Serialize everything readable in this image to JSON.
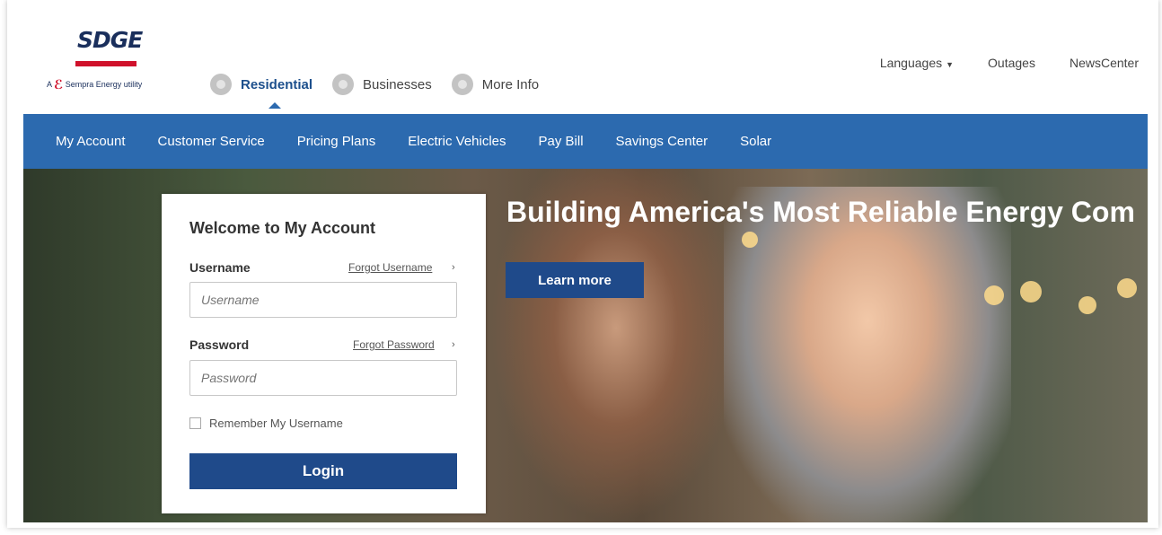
{
  "brand": {
    "logo_text": "SDGE",
    "tagline": "Sempra Energy utility",
    "colors": {
      "primary": "#2c6aaf",
      "button": "#1f4a8a",
      "brand_red": "#d0112b"
    }
  },
  "segments": [
    {
      "label": "Residential",
      "active": true
    },
    {
      "label": "Businesses",
      "active": false
    },
    {
      "label": "More Info",
      "active": false
    }
  ],
  "utility_nav": {
    "languages": "Languages",
    "outages": "Outages",
    "newscenter": "NewsCenter"
  },
  "main_nav": [
    "My Account",
    "Customer Service",
    "Pricing Plans",
    "Electric Vehicles",
    "Pay Bill",
    "Savings Center",
    "Solar"
  ],
  "hero": {
    "title": "Building America's Most Reliable Energy Com",
    "cta": "Learn more"
  },
  "login": {
    "title": "Welcome to My Account",
    "username_label": "Username",
    "forgot_username": "Forgot Username",
    "username_placeholder": "Username",
    "password_label": "Password",
    "forgot_password": "Forgot Password",
    "password_placeholder": "Password",
    "remember_label": "Remember My Username",
    "submit": "Login"
  }
}
